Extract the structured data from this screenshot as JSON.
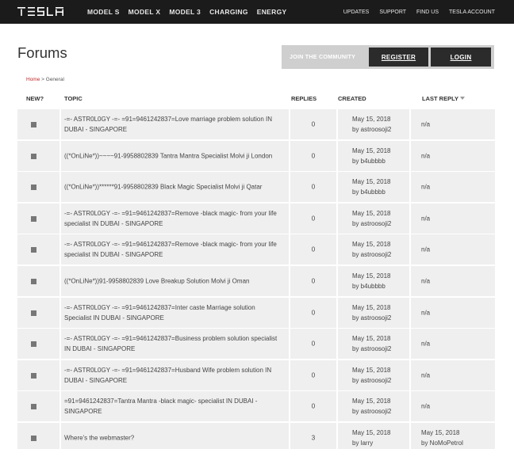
{
  "nav": {
    "logo_text": "TESLA",
    "main": [
      "MODEL S",
      "MODEL X",
      "MODEL 3",
      "CHARGING",
      "ENERGY"
    ],
    "secondary": [
      "UPDATES",
      "SUPPORT",
      "FIND US",
      "TESLA ACCOUNT"
    ]
  },
  "page": {
    "title": "Forums",
    "community_label": "JOIN THE COMMUNITY",
    "register_label": "REGISTER",
    "login_label": "LOGIN"
  },
  "breadcrumb": {
    "home": "Home",
    "separator": ">",
    "current": "General"
  },
  "table": {
    "headers": {
      "new": "NEW?",
      "topic": "TOPIC",
      "replies": "REPLIES",
      "created": "CREATED",
      "last_reply": "LAST REPLY"
    },
    "rows": [
      {
        "topic": "-=- ASTR0L0GY -=- =91=9461242837=Love marriage problem solution IN DUBAI - SINGAPORE",
        "replies": "0",
        "created_date": "May 15, 2018",
        "created_by": "by astroosoji2",
        "last_reply_1": "n/a",
        "last_reply_2": ""
      },
      {
        "topic": "((*OnLiNe*))~~~~91-9958802839 Tantra Mantra Specialist Molvi ji London",
        "replies": "0",
        "created_date": "May 15, 2018",
        "created_by": "by b4ubbbb",
        "last_reply_1": "n/a",
        "last_reply_2": ""
      },
      {
        "topic": "((*OnLiNe*))******91-9958802839 Black Magic Specialist Molvi ji Qatar",
        "replies": "0",
        "created_date": "May 15, 2018",
        "created_by": "by b4ubbbb",
        "last_reply_1": "n/a",
        "last_reply_2": ""
      },
      {
        "topic": "-=- ASTR0L0GY -=- =91=9461242837=Remove -black magic- from your life specialist IN DUBAI - SINGAPORE",
        "replies": "0",
        "created_date": "May 15, 2018",
        "created_by": "by astroosoji2",
        "last_reply_1": "n/a",
        "last_reply_2": ""
      },
      {
        "topic": "-=- ASTR0L0GY -=- =91=9461242837=Remove -black magic- from your life specialist IN DUBAI - SINGAPORE",
        "replies": "0",
        "created_date": "May 15, 2018",
        "created_by": "by astroosoji2",
        "last_reply_1": "n/a",
        "last_reply_2": ""
      },
      {
        "topic": "((*OnLiNe*))91-9958802839 Love Breakup Solution Molvi ji Oman",
        "replies": "0",
        "created_date": "May 15, 2018",
        "created_by": "by b4ubbbb",
        "last_reply_1": "n/a",
        "last_reply_2": ""
      },
      {
        "topic": "-=- ASTR0L0GY -=- =91=9461242837=Inter caste Marriage solution Specialist IN DUBAI - SINGAPORE",
        "replies": "0",
        "created_date": "May 15, 2018",
        "created_by": "by astroosoji2",
        "last_reply_1": "n/a",
        "last_reply_2": ""
      },
      {
        "topic": "-=- ASTR0L0GY -=- =91=9461242837=Business problem solution specialist IN DUBAI - SINGAPORE",
        "replies": "0",
        "created_date": "May 15, 2018",
        "created_by": "by astroosoji2",
        "last_reply_1": "n/a",
        "last_reply_2": ""
      },
      {
        "topic": "-=- ASTR0L0GY -=- =91=9461242837=Husband Wife problem solution IN DUBAI - SINGAPORE",
        "replies": "0",
        "created_date": "May 15, 2018",
        "created_by": "by astroosoji2",
        "last_reply_1": "n/a",
        "last_reply_2": ""
      },
      {
        "topic": "=91=9461242837=Tantra Mantra -black magic- specialist IN DUBAI - SINGAPORE",
        "replies": "0",
        "created_date": "May 15, 2018",
        "created_by": "by astroosoji2",
        "last_reply_1": "n/a",
        "last_reply_2": ""
      },
      {
        "topic": "Where's the webmaster?",
        "replies": "3",
        "created_date": "May 15, 2018",
        "created_by": "by larry",
        "last_reply_1": "May 15, 2018",
        "last_reply_2": "by NoMoPetrol"
      }
    ]
  }
}
